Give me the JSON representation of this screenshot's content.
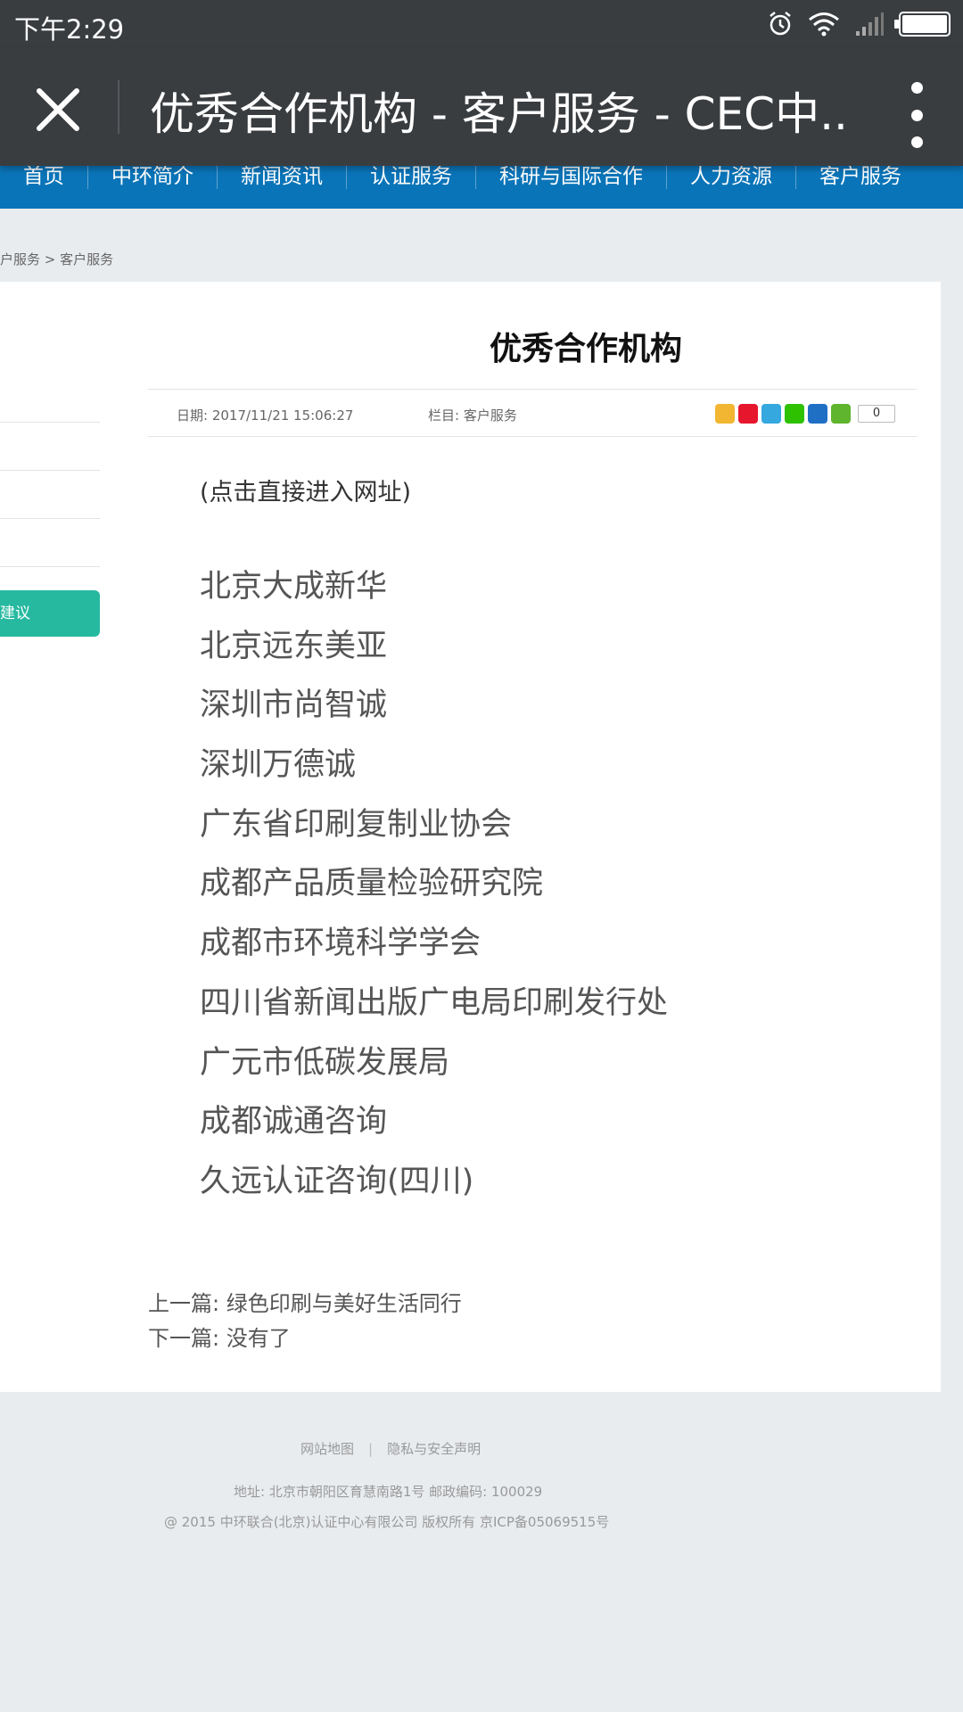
{
  "status": {
    "time": "下午2:29"
  },
  "browser": {
    "title": "优秀合作机构 - 客户服务 - CEC中..."
  },
  "nav": {
    "items": [
      "首页",
      "中环简介",
      "新闻资讯",
      "认证服务",
      "科研与国际合作",
      "人力资源",
      "客户服务"
    ]
  },
  "breadcrumb": "户服务 > 客户服务",
  "sidebar": {
    "suggest_label": "建议"
  },
  "article": {
    "title": "优秀合作机构",
    "date": "日期: 2017/11/21 15:06:27",
    "column": "栏目: 客户服务",
    "share_count": "0",
    "hint": "(点击直接进入网址)",
    "orgs": [
      "北京大成新华",
      "北京远东美亚",
      "深圳市尚智诚",
      "深圳万德诚",
      "广东省印刷复制业协会",
      "成都产品质量检验研究院",
      "成都市环境科学学会",
      "四川省新闻出版广电局印刷发行处",
      "广元市低碳发展局",
      "成都诚通咨询",
      "久远认证咨询(四川)"
    ],
    "prev": "上一篇: 绿色印刷与美好生活同行",
    "next": "下一篇: 没有了"
  },
  "footer": {
    "sitemap": "网站地图",
    "privacy": "隐私与安全声明",
    "address": "地址: 北京市朝阳区育慧南路1号 邮政编码: 100029",
    "copyright": "@ 2015 中环联合(北京)认证中心有限公司 版权所有 京ICP备05069515号"
  },
  "share_icons": [
    {
      "name": "qzone-icon",
      "color": "#f2b632"
    },
    {
      "name": "weibo-icon",
      "color": "#e6162d"
    },
    {
      "name": "tqq-icon",
      "color": "#35a8e0"
    },
    {
      "name": "wechat-icon",
      "color": "#2dc100"
    },
    {
      "name": "renren-icon",
      "color": "#1f6fc5"
    },
    {
      "name": "more-share-icon",
      "color": "#5fb52d"
    }
  ]
}
